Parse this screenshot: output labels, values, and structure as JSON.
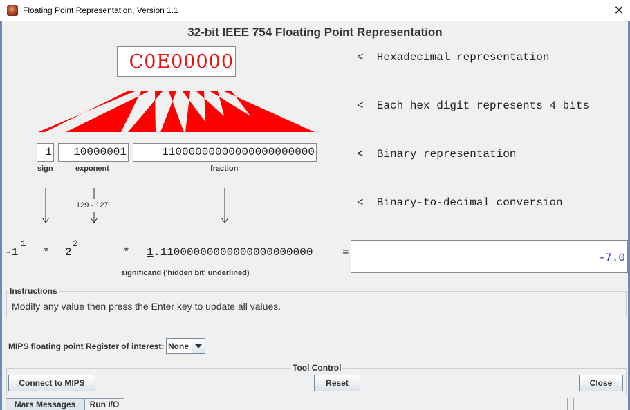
{
  "window": {
    "title": "Floating Point Representation, Version 1.1",
    "close_icon": "close-icon"
  },
  "heading": "32-bit IEEE 754 Floating Point Representation",
  "hex_value": "C0E00000",
  "annotations": {
    "hex": "<  Hexadecimal representation",
    "digit": "<  Each hex digit represents 4 bits",
    "binary": "<  Binary representation",
    "conversion": "<  Binary-to-decimal conversion"
  },
  "fields": {
    "sign": {
      "value": "1",
      "label": "sign"
    },
    "exponent": {
      "value": "10000001",
      "label": "exponent"
    },
    "fraction": {
      "value": "11000000000000000000000",
      "label": "fraction"
    }
  },
  "exponent_calc": "129 - 127",
  "formula": {
    "sign_base": "-1",
    "sign_power": "1",
    "times1": "*",
    "two_base": "2",
    "two_power": "2",
    "times2": "*",
    "hidden_bit": "1",
    "significand_rest": ".11000000000000000000000",
    "equals": "=",
    "significand_label": "significand ('hidden bit' underlined)"
  },
  "decimal_value": "-7.0",
  "instructions": {
    "legend": "Instructions",
    "text": "Modify any value then press the Enter key to update all values."
  },
  "register": {
    "label": "MIPS floating point Register of interest:",
    "selected": "None"
  },
  "tool_control": {
    "legend": "Tool Control",
    "connect": "Connect to MIPS",
    "reset": "Reset",
    "close": "Close"
  },
  "tabs": [
    "Mars Messages",
    "Run I/O"
  ],
  "colors": {
    "hex_text": "#ee1111",
    "triangles": "#ff0000",
    "result_text": "#2b2bd0"
  }
}
